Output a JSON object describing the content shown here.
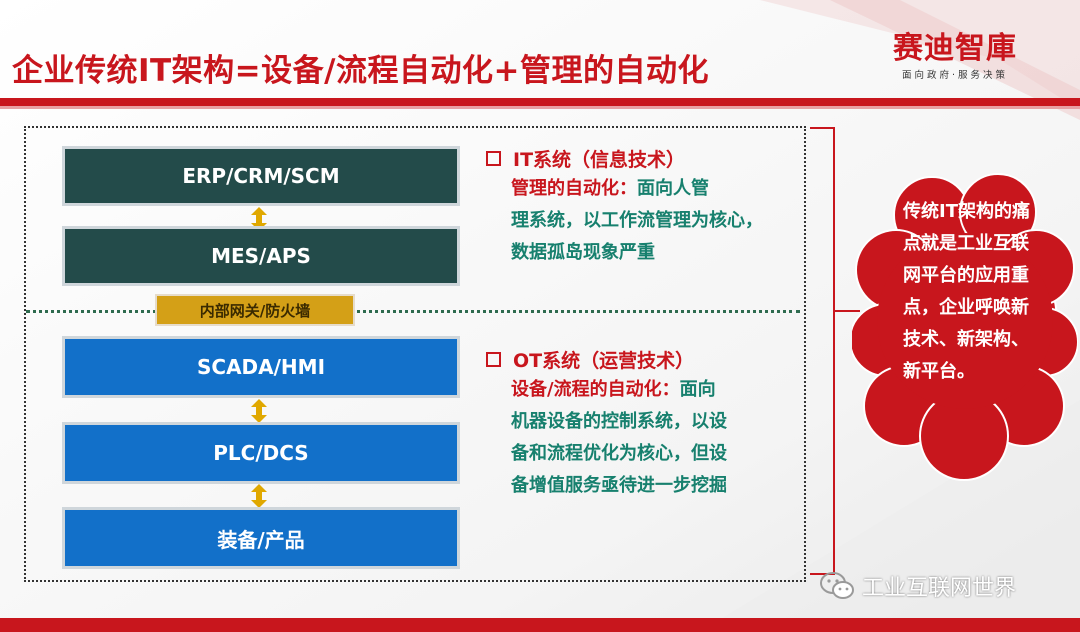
{
  "title": "企业传统IT架构=设备/流程自动化+管理的自动化",
  "logo": {
    "name": "赛迪智庫",
    "slogan": "面向政府·服务决策"
  },
  "it_stack": {
    "erp": "ERP/CRM/SCM",
    "mes": "MES/APS"
  },
  "gateway": "内部网关/防火墙",
  "ot_stack": {
    "scada": "SCADA/HMI",
    "plc": "PLC/DCS",
    "equipment": "装备/产品"
  },
  "it_system": {
    "heading": "IT系统（信息技术）",
    "lead": "管理的自动化：",
    "text": "面向人管理系统，以工作流管理为核心，数据孤岛现象严重"
  },
  "ot_system": {
    "heading": "OT系统（运营技术）",
    "lead": "设备/流程的自动化：",
    "text": "面向机器设备的控制系统，以设备和流程优化为核心，但设备增值服务亟待进一步挖掘"
  },
  "callout": "传统IT架构的痛点就是工业互联网平台的应用重点，企业呼唤新技术、新架构、新平台。",
  "watermark": "工业互联网世界",
  "colors": {
    "brand_red": "#c8161d",
    "it_box": "#234b4a",
    "ot_box": "#1270c9",
    "gateway": "#d4a017",
    "teal_text": "#17806e"
  }
}
